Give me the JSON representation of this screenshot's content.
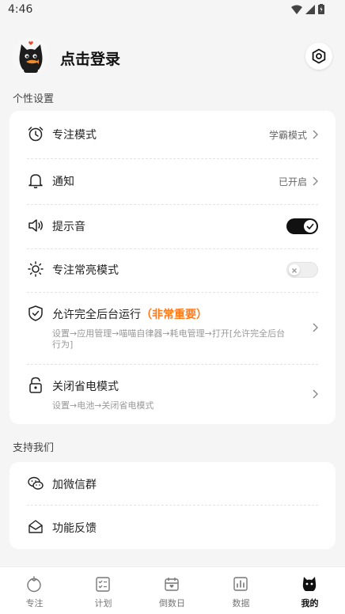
{
  "status_bar": {
    "time": "4:46"
  },
  "header": {
    "login_label": "点击登录"
  },
  "sections": {
    "personal": {
      "title": "个性设置",
      "focus_mode": {
        "label": "专注模式",
        "value": "学霸模式"
      },
      "notification": {
        "label": "通知",
        "value": "已开启"
      },
      "sound": {
        "label": "提示音",
        "enabled": true
      },
      "screen_on": {
        "label": "专注常亮模式",
        "enabled": false
      },
      "background": {
        "label": "允许完全后台运行",
        "emphasis": "（非常重要）",
        "sub": "设置→应用管理→喵喵自律器→耗电管理→打开[允许完全后台行为]"
      },
      "power_saving": {
        "label": "关闭省电模式",
        "sub": "设置→电池→关闭省电模式"
      }
    },
    "support": {
      "title": "支持我们",
      "wechat_group": {
        "label": "加微信群"
      },
      "feedback": {
        "label": "功能反馈"
      }
    }
  },
  "tabs": [
    {
      "label": "专注",
      "icon": "tomato-icon"
    },
    {
      "label": "计划",
      "icon": "checklist-icon"
    },
    {
      "label": "倒数日",
      "icon": "calendar-icon"
    },
    {
      "label": "数据",
      "icon": "bar-chart-icon"
    },
    {
      "label": "我的",
      "icon": "cat-icon",
      "active": true
    }
  ],
  "colors": {
    "accent": "#ff7a1a",
    "toggle_on": "#111111",
    "background": "#f5f5f5"
  }
}
